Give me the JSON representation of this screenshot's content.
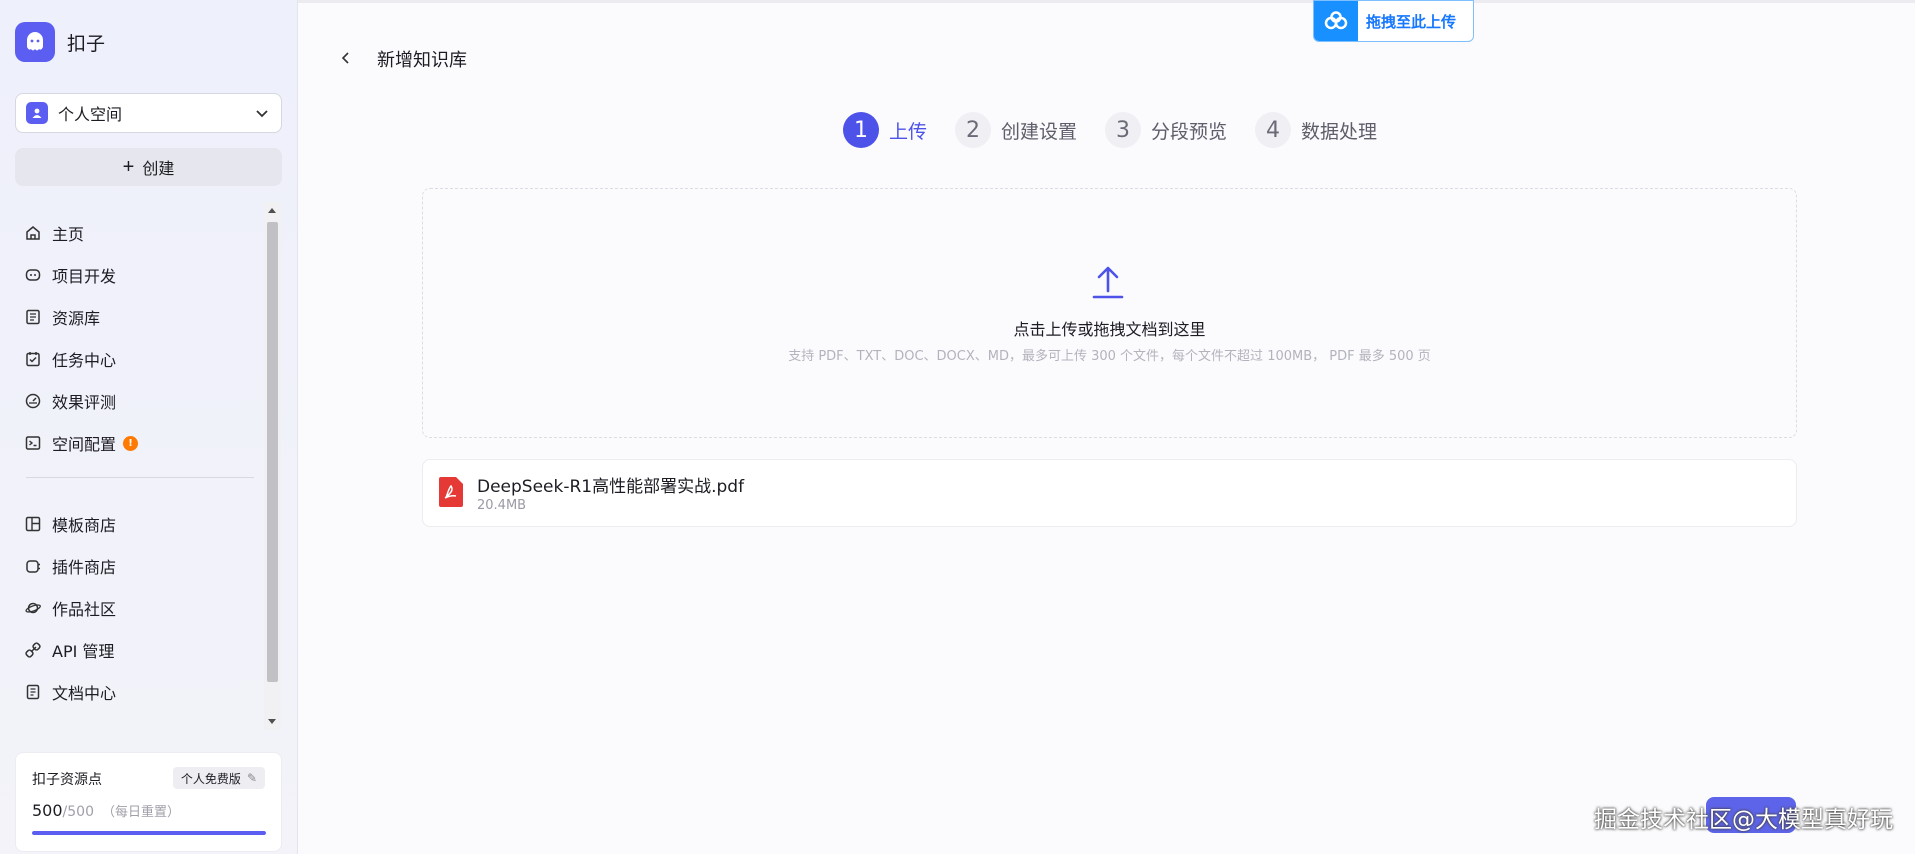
{
  "brand": {
    "name": "扣子",
    "logo_icon": "coze-logo-icon",
    "accent": "#5b5ef1"
  },
  "workspace": {
    "label": "个人空间"
  },
  "create_button": {
    "label": "创建"
  },
  "nav": {
    "primary": [
      {
        "label": "主页",
        "icon": "home-icon"
      },
      {
        "label": "项目开发",
        "icon": "bot-icon"
      },
      {
        "label": "资源库",
        "icon": "library-icon"
      },
      {
        "label": "任务中心",
        "icon": "task-icon"
      },
      {
        "label": "效果评测",
        "icon": "gauge-icon"
      },
      {
        "label": "空间配置",
        "icon": "terminal-icon",
        "badge": "!"
      }
    ],
    "secondary": [
      {
        "label": "模板商店",
        "icon": "template-icon"
      },
      {
        "label": "插件商店",
        "icon": "plugin-icon"
      },
      {
        "label": "作品社区",
        "icon": "planet-icon"
      },
      {
        "label": "API 管理",
        "icon": "link-icon"
      },
      {
        "label": "文档中心",
        "icon": "document-icon"
      }
    ]
  },
  "points": {
    "title": "扣子资源点",
    "plan": "个人免费版",
    "value": "500",
    "total": "/500",
    "note": "（每日重置）",
    "fraction": 1.0
  },
  "header": {
    "title": "新增知识库",
    "drag_upload_label": "拖拽至此上传"
  },
  "steps": [
    {
      "num": "1",
      "label": "上传",
      "active": true
    },
    {
      "num": "2",
      "label": "创建设置",
      "active": false
    },
    {
      "num": "3",
      "label": "分段预览",
      "active": false
    },
    {
      "num": "4",
      "label": "数据处理",
      "active": false
    }
  ],
  "dropzone": {
    "title": "点击上传或拖拽文档到这里",
    "hint": "支持 PDF、TXT、DOC、DOCX、MD，最多可上传 300 个文件，每个文件不超过 100MB， PDF 最多 500 页"
  },
  "file": {
    "name": "DeepSeek-R1高性能部署实战.pdf",
    "size": "20.4MB"
  },
  "watermark": "掘金技术社区@大模型真好玩"
}
